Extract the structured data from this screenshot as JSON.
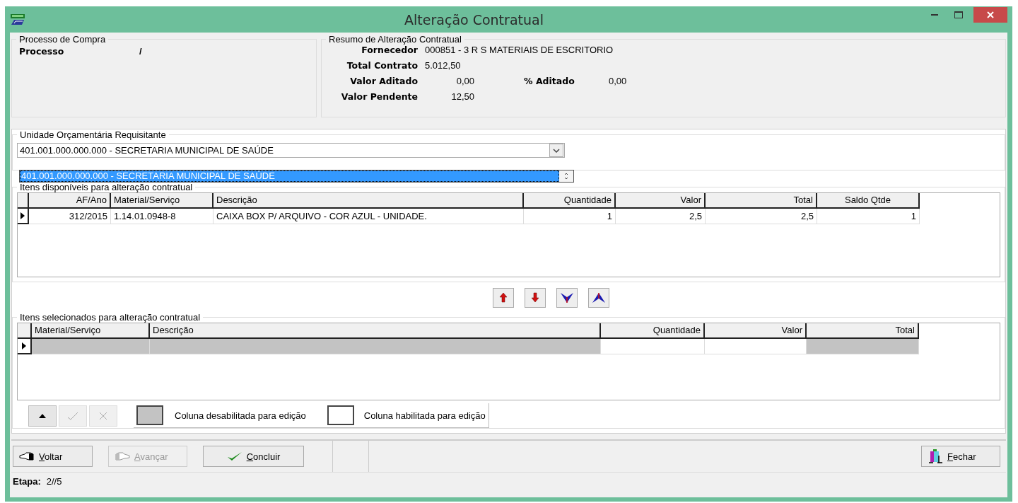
{
  "window": {
    "title": "Alteração Contratual"
  },
  "purchase_process": {
    "title": "Processo de Compra",
    "label": "Processo",
    "value": "/"
  },
  "summary": {
    "title": "Resumo de Alteração Contratual",
    "rows": [
      [
        {
          "label": "Fornecedor",
          "value": "000851 - 3 R S MATERIAIS DE ESCRITORIO"
        }
      ],
      [
        {
          "label": "Total Contrato",
          "value": "5.012,50"
        }
      ],
      [
        {
          "label": "Valor Aditado",
          "value": "0,00"
        },
        {
          "label": "% Aditado",
          "value": "0,00"
        }
      ],
      [
        {
          "label": "Valor Pendente",
          "value": "12,50"
        }
      ]
    ]
  },
  "budget_unit": {
    "title": "Unidade Orçamentária Requisitante",
    "value": "401.001.000.000.000 - SECRETARIA MUNICIPAL DE SAÚDE",
    "expanded": true,
    "options": [
      {
        "label": "401.001.000.000.000 - SECRETARIA MUNICIPAL DE SAÚDE",
        "selected": true
      }
    ]
  },
  "available_items": {
    "title": "Itens disponíveis para alteração contratual",
    "columns": [
      "AF/Ano",
      "Material/Serviço",
      "Descrição",
      "Quantidade",
      "Valor",
      "Total",
      "Saldo Qtde"
    ],
    "rows": [
      {
        "current": true,
        "cells": [
          "312/2015",
          "1.14.01.0948-8",
          "CAIXA BOX P/ ARQUIVO - COR AZUL - UNIDADE.",
          "1",
          "2,5",
          "2,5",
          "1"
        ]
      }
    ]
  },
  "move_buttons": [
    {
      "kind": "up"
    },
    {
      "kind": "down"
    },
    {
      "kind": "all-down"
    },
    {
      "kind": "all-up"
    }
  ],
  "selected_items": {
    "title": "Itens selecionados para alteração contratual",
    "columns": [
      {
        "label": "Material/Serviço",
        "editable": false
      },
      {
        "label": "Descrição",
        "editable": false
      },
      {
        "label": "Quantidade",
        "editable": true
      },
      {
        "label": "Valor",
        "editable": true
      },
      {
        "label": "Total",
        "editable": false
      }
    ],
    "rows": [
      {
        "current": true
      }
    ]
  },
  "grid_tools": [
    {
      "kind": "up",
      "disabled": false
    },
    {
      "kind": "confirm",
      "disabled": true
    },
    {
      "kind": "cancel",
      "disabled": true
    }
  ],
  "legend": [
    {
      "label": "Coluna desabilitada para edição",
      "editable": false
    },
    {
      "label": "Coluna habilitada para edição",
      "editable": true
    }
  ],
  "footer_buttons": [
    {
      "kind": "back",
      "label": "Voltar",
      "disabled": false
    },
    {
      "kind": "forward",
      "label": "Avançar",
      "disabled": true
    },
    {
      "kind": "confirm",
      "label": "Concluir",
      "disabled": false
    }
  ],
  "close_button": {
    "label": "Fechar"
  },
  "status": {
    "label": "Etapa:",
    "value": "2//5"
  }
}
